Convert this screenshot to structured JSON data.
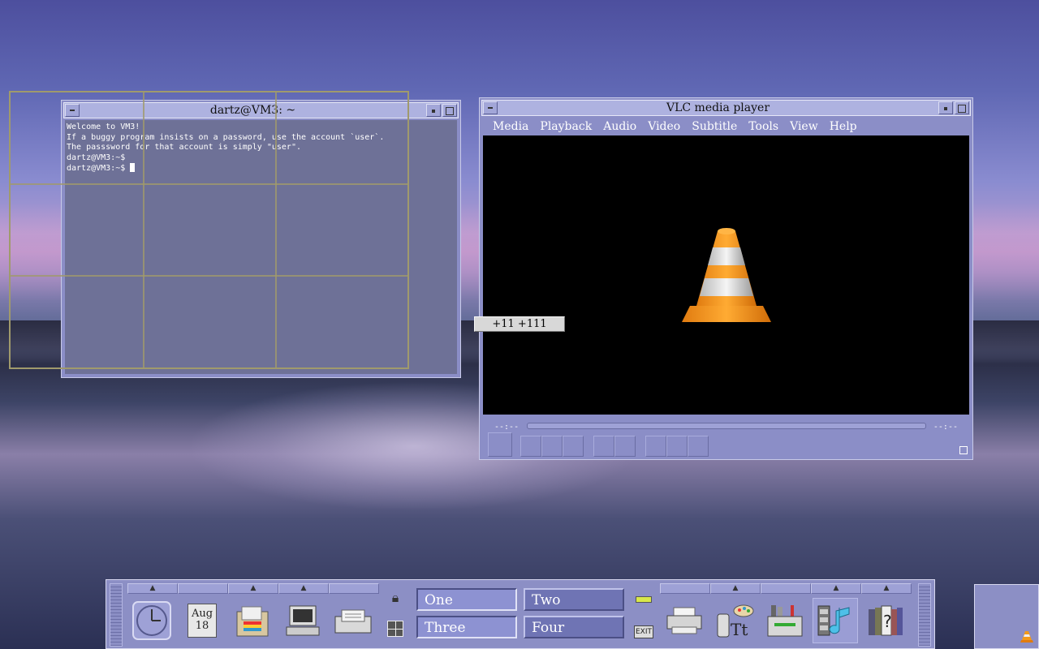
{
  "terminal": {
    "title": "dartz@VM3: ~",
    "lines": [
      "Welcome to VM3!",
      "If a buggy program insists on a password, use the account `user`.",
      "The passsword for that account is simply \"user\".",
      "",
      "dartz@VM3:~$",
      "dartz@VM3:~$ "
    ]
  },
  "vlc": {
    "title": "VLC media player",
    "menu": [
      "Media",
      "Playback",
      "Audio",
      "Video",
      "Subtitle",
      "Tools",
      "View",
      "Help"
    ],
    "time_elapsed": "--:--",
    "time_total": "--:--"
  },
  "geometry": "+11  +111",
  "panel": {
    "date_month": "Aug",
    "date_day": "18",
    "workspaces": [
      "One",
      "Two",
      "Three",
      "Four"
    ],
    "exit_label": "EXIT"
  },
  "colors": {
    "window_frame": "#8b8ec7",
    "titlebar": "#aeb2e0",
    "terminal_bg": "#6e7197",
    "panel_bg": "#8c8fc5",
    "workspace_active": "#8d92d2",
    "vlc_orange": "#f39a1a"
  }
}
